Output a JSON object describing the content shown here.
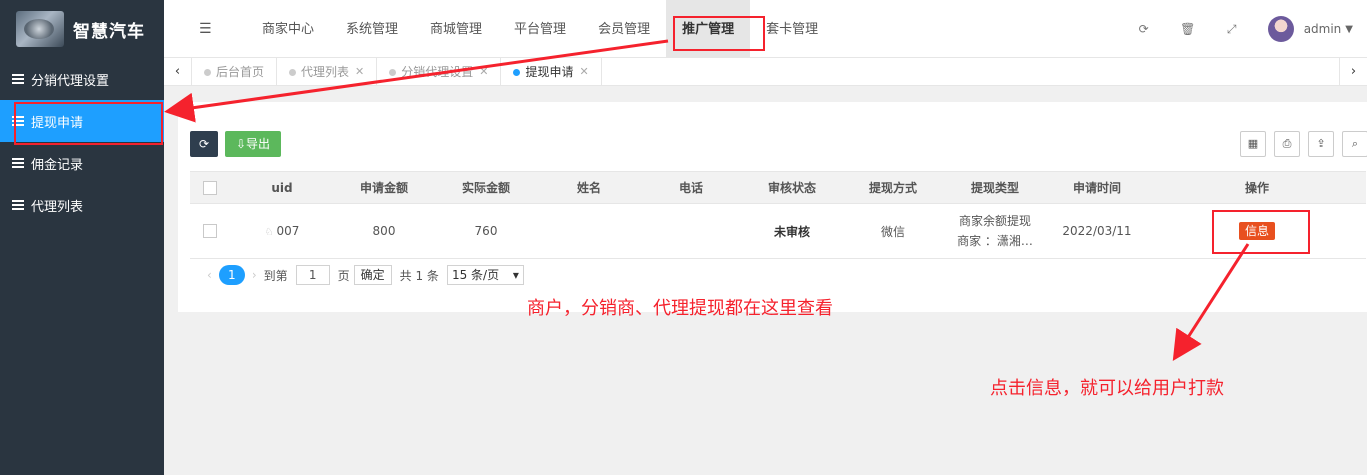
{
  "header": {
    "logo_text": "智慧汽车",
    "menu_toggle_icon": "menu-fold-icon",
    "nav": [
      "商家中心",
      "系统管理",
      "商城管理",
      "平台管理",
      "会员管理",
      "推广管理",
      "套卡管理"
    ],
    "active_nav": "推广管理",
    "user_name": "admin",
    "icons": [
      "refresh-icon",
      "trash-icon",
      "fullscreen-icon"
    ]
  },
  "sidebar": {
    "items": [
      "分销代理设置",
      "提现申请",
      "佣金记录",
      "代理列表"
    ],
    "active": "提现申请"
  },
  "tabs": {
    "items": [
      "后台首页",
      "代理列表",
      "分销代理设置",
      "提现申请"
    ],
    "active": "提现申请",
    "close_glyph": "✕",
    "left_arrow": "‹",
    "right_arrow": "›"
  },
  "toolbar": {
    "export_label": "导出",
    "tool_icons": [
      "columns-icon",
      "print-icon",
      "export-icon",
      "search-icon"
    ]
  },
  "table": {
    "columns": [
      "uid",
      "申请金额",
      "实际金额",
      "姓名",
      "电话",
      "审核状态",
      "提现方式",
      "提现类型",
      "申请时间",
      "操作"
    ],
    "rows": [
      {
        "uid": "007",
        "apply_amount": "800",
        "actual_amount": "760",
        "name": "",
        "phone": "",
        "status": "未审核",
        "method": "微信",
        "type_line1": "商家余额提现",
        "type_line2": "商家 ：潇湘…",
        "time": "2022/03/11",
        "action": "信息"
      }
    ]
  },
  "pager": {
    "current": "1",
    "goto_label": "到第",
    "page_input": "1",
    "page_unit": "页",
    "confirm": "确定",
    "total": "共 1 条",
    "page_size": "15 条/页"
  },
  "annotations": {
    "note1": "商户，分销商、代理提现都在这里查看",
    "note2": "点击信息，就可以给用户打款",
    "color": "#f5222d"
  }
}
